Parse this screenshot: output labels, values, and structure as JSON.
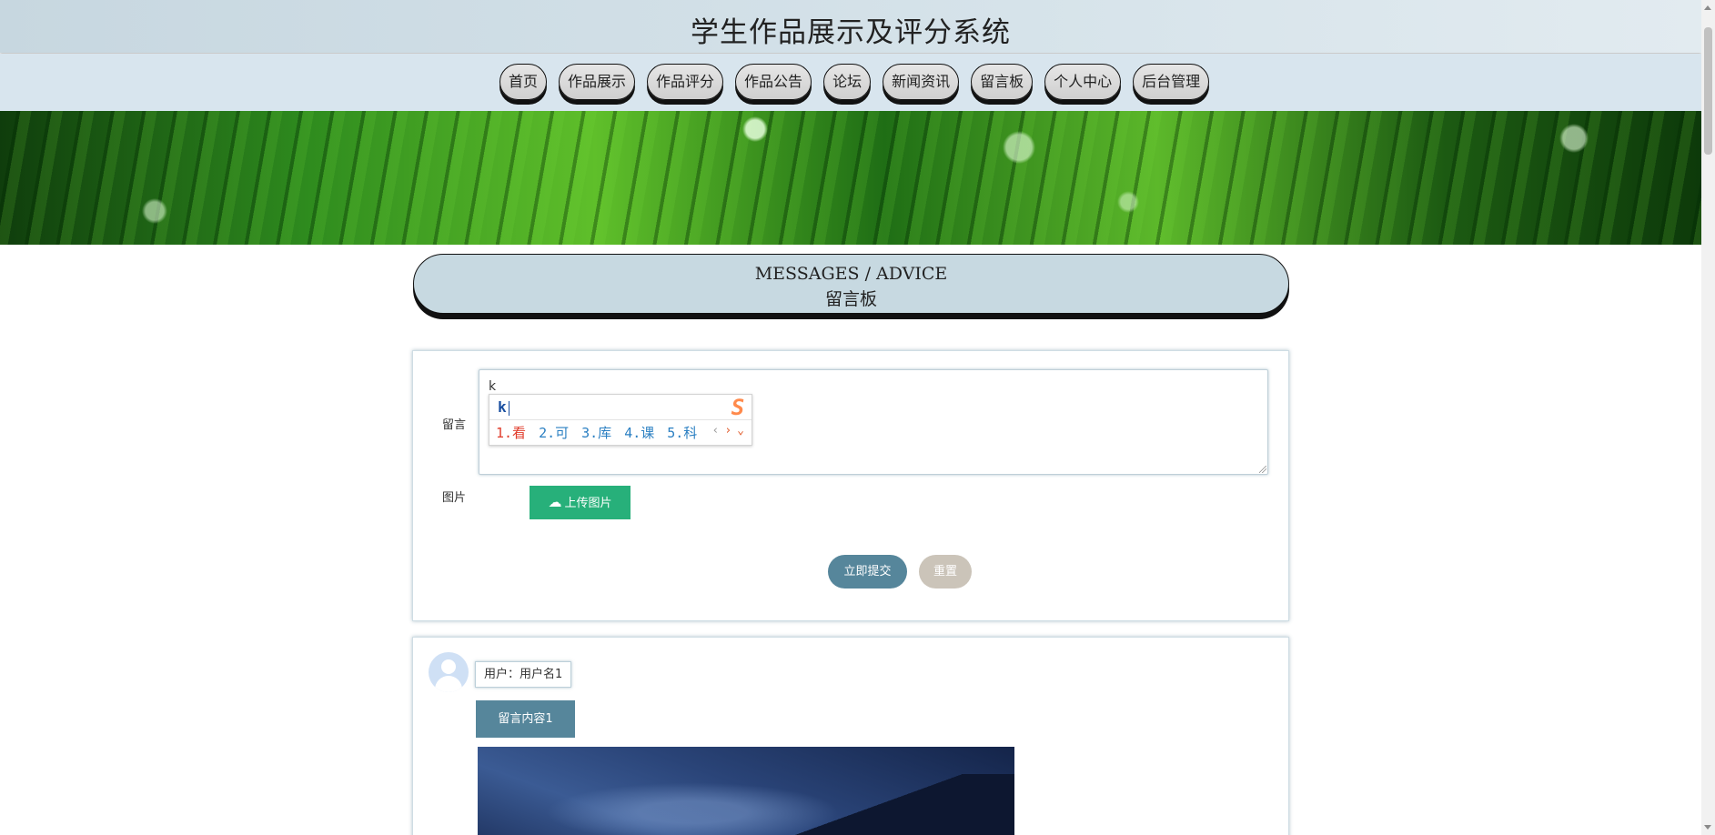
{
  "header": {
    "title": "学生作品展示及评分系统"
  },
  "nav": {
    "items": [
      "首页",
      "作品展示",
      "作品评分",
      "作品公告",
      "论坛",
      "新闻资讯",
      "留言板",
      "个人中心",
      "后台管理"
    ]
  },
  "section": {
    "title_en": "MESSAGES / ADVICE",
    "title_zh": "留言板"
  },
  "form": {
    "message_label": "留言",
    "message_value": "k",
    "image_label": "图片",
    "upload_label": "上传图片",
    "submit_label": "立即提交",
    "reset_label": "重置"
  },
  "ime": {
    "composition": "k",
    "candidates": [
      "1.看",
      "2.可",
      "3.库",
      "4.课",
      "5.科"
    ],
    "logo": "S"
  },
  "messages": [
    {
      "user": "用户：用户名1",
      "content": "留言内容1"
    }
  ],
  "colors": {
    "header_bg": "#c7d7e0",
    "nav_bg": "#d8e5ee",
    "primary": "#56869b",
    "upload": "#27b07a",
    "reset": "#cbc4b9"
  }
}
